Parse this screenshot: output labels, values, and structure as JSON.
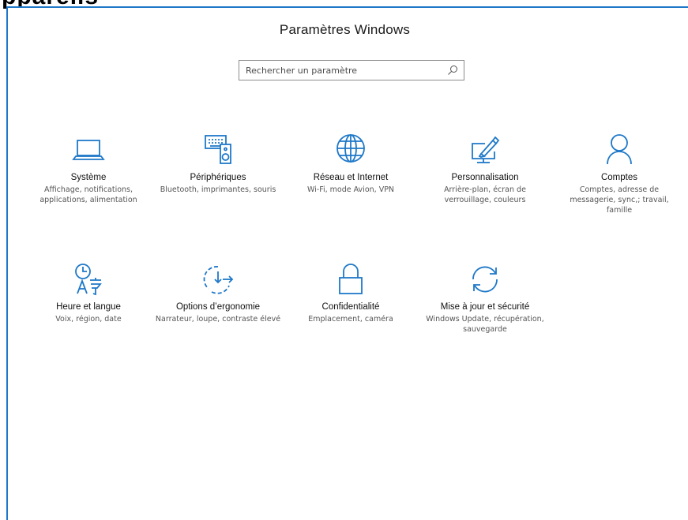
{
  "cutoff_text": "ppareils",
  "window": {
    "title": "Paramètres Windows",
    "search_placeholder": "Rechercher un paramètre"
  },
  "colors": {
    "accent": "#1e78c8",
    "border": "#1e78c8"
  },
  "tiles": [
    {
      "icon": "laptop-icon",
      "name": "Système",
      "desc": "Affichage, notifications, applications, alimentation"
    },
    {
      "icon": "keyboard-speaker-icon",
      "name": "Périphériques",
      "desc": "Bluetooth, imprimantes, souris"
    },
    {
      "icon": "globe-icon",
      "name": "Réseau et Internet",
      "desc": "Wi-Fi, mode Avion, VPN"
    },
    {
      "icon": "paint-monitor-icon",
      "name": "Personnalisation",
      "desc": "Arrière-plan, écran de verrouillage, couleurs"
    },
    {
      "icon": "person-icon",
      "name": "Comptes",
      "desc": "Comptes, adresse de messagerie, sync,; travail, famille"
    },
    {
      "icon": "time-language-icon",
      "name": "Heure et langue",
      "desc": "Voix, région, date"
    },
    {
      "icon": "ease-of-access-icon",
      "name": "Options d’ergonomie",
      "desc": "Narrateur, loupe, contraste élevé"
    },
    {
      "icon": "lock-icon",
      "name": "Confidentialité",
      "desc": "Emplacement, caméra"
    },
    {
      "icon": "sync-icon",
      "name": "Mise à jour et sécurité",
      "desc": "Windows Update, récupération, sauvegarde"
    }
  ]
}
